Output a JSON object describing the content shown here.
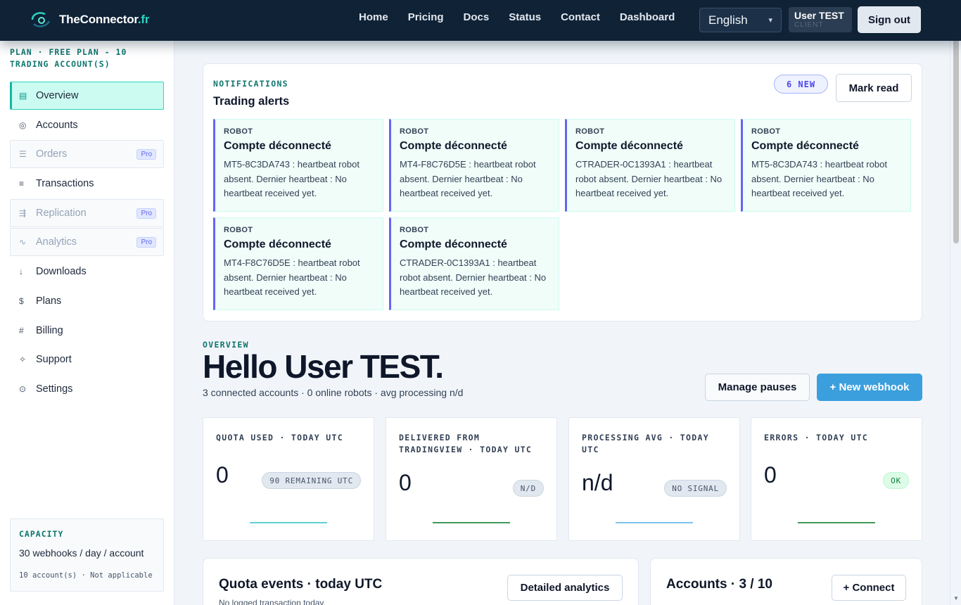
{
  "brand": {
    "name": "TheConnector",
    "tld": ".fr"
  },
  "nav": {
    "links": [
      "Home",
      "Pricing",
      "Docs",
      "Status",
      "Contact",
      "Dashboard"
    ]
  },
  "language": {
    "selected": "English"
  },
  "user": {
    "name": "User TEST",
    "role": "CLIENT",
    "signout_label": "Sign out"
  },
  "sidebar": {
    "plan": "PLAN · FREE PLAN - 10 TRADING ACCOUNT(S)",
    "items": [
      {
        "label": "Overview",
        "icon": "▤",
        "state": "active"
      },
      {
        "label": "Accounts",
        "icon": "◎",
        "state": "normal"
      },
      {
        "label": "Orders",
        "icon": "☰",
        "state": "locked",
        "badge": "Pro"
      },
      {
        "label": "Transactions",
        "icon": "≡",
        "state": "normal"
      },
      {
        "label": "Replication",
        "icon": "⇶",
        "state": "locked",
        "badge": "Pro"
      },
      {
        "label": "Analytics",
        "icon": "∿",
        "state": "locked",
        "badge": "Pro"
      },
      {
        "label": "Downloads",
        "icon": "↓",
        "state": "normal"
      },
      {
        "label": "Plans",
        "icon": "$",
        "state": "normal"
      },
      {
        "label": "Billing",
        "icon": "#",
        "state": "normal"
      },
      {
        "label": "Support",
        "icon": "✧",
        "state": "normal"
      },
      {
        "label": "Settings",
        "icon": "⊙",
        "state": "normal"
      }
    ],
    "capacity": {
      "title": "CAPACITY",
      "value": "30 webhooks / day / account",
      "footer": "10 account(s) · Not applicable"
    }
  },
  "notifications": {
    "eyebrow": "NOTIFICATIONS",
    "title": "Trading alerts",
    "badge": "6 NEW",
    "mark_read_label": "Mark read",
    "alerts": [
      {
        "source": "ROBOT",
        "title": "Compte déconnecté",
        "message": "MT5-8C3DA743 : heartbeat robot absent. Dernier heartbeat : No heartbeat received yet."
      },
      {
        "source": "ROBOT",
        "title": "Compte déconnecté",
        "message": "MT4-F8C76D5E : heartbeat robot absent. Dernier heartbeat : No heartbeat received yet."
      },
      {
        "source": "ROBOT",
        "title": "Compte déconnecté",
        "message": "CTRADER-0C1393A1 : heartbeat robot absent. Dernier heartbeat : No heartbeat received yet."
      },
      {
        "source": "ROBOT",
        "title": "Compte déconnecté",
        "message": "MT5-8C3DA743 : heartbeat robot absent. Dernier heartbeat : No heartbeat received yet."
      },
      {
        "source": "ROBOT",
        "title": "Compte déconnecté",
        "message": "MT4-F8C76D5E : heartbeat robot absent. Dernier heartbeat : No heartbeat received yet."
      },
      {
        "source": "ROBOT",
        "title": "Compte déconnecté",
        "message": "CTRADER-0C1393A1 : heartbeat robot absent. Dernier heartbeat : No heartbeat received yet."
      }
    ]
  },
  "overview": {
    "eyebrow": "OVERVIEW",
    "greeting": "Hello User TEST.",
    "subtitle": "3 connected accounts · 0 online robots · avg processing n/d",
    "manage_pauses_label": "Manage pauses",
    "new_webhook_label": "+ New webhook"
  },
  "stats": [
    {
      "label": "QUOTA USED · TODAY UTC",
      "value": "0",
      "badge": "90 REMAINING UTC",
      "badge_kind": "grey",
      "line_color": "#5fd0cf"
    },
    {
      "label": "DELIVERED FROM TRADINGVIEW · TODAY UTC",
      "value": "0",
      "badge": "N/D",
      "badge_kind": "grey",
      "line_color": "#3f9a57"
    },
    {
      "label": "PROCESSING AVG · TODAY UTC",
      "value": "n/d",
      "badge": "NO SIGNAL",
      "badge_kind": "grey",
      "line_color": "#7cc4ee"
    },
    {
      "label": "ERRORS · TODAY UTC",
      "value": "0",
      "badge": "OK",
      "badge_kind": "ok",
      "line_color": "#3f9a57"
    }
  ],
  "panels": {
    "quota": {
      "title": "Quota events · today UTC",
      "subtitle": "No logged transaction today.",
      "button": "Detailed analytics"
    },
    "accounts": {
      "title": "Accounts · 3 / 10",
      "button": "+ Connect"
    }
  }
}
